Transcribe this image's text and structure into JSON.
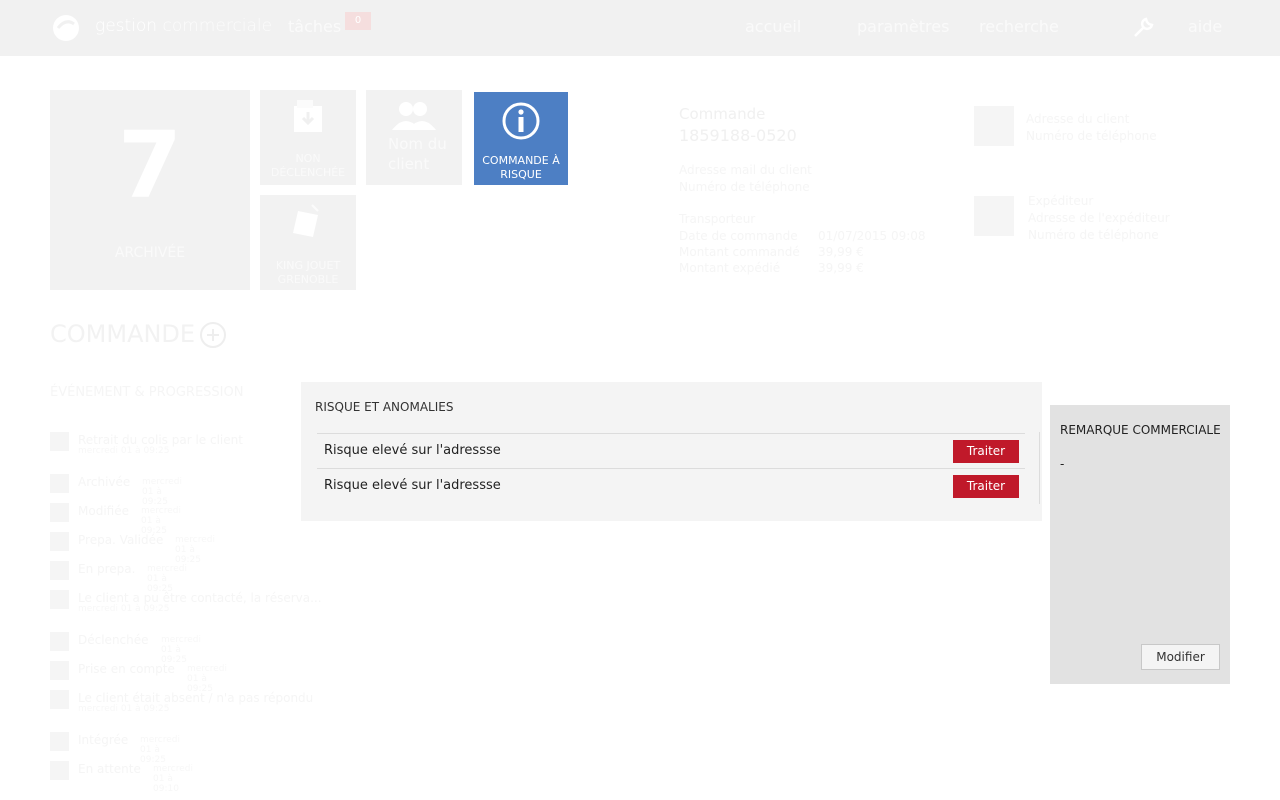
{
  "header": {
    "brand_main": "gestion",
    "brand_sub": "commerciale",
    "tasks_label": "tâches",
    "tasks_count": "0",
    "nav": [
      "accueil",
      "paramètres",
      "recherche",
      "aide"
    ]
  },
  "tiles": {
    "archived_count": "7",
    "archived_label": "ARCHIVÉE",
    "not_triggered_label": "NON DÉCLENCHÉE",
    "client_name_label": "Nom du client",
    "risk_label": "COMMANDE À RISQUE",
    "vendor_label": "KING JOUET GRENOBLE"
  },
  "order": {
    "label": "Commande",
    "number": "1859188-0520",
    "email_label": "Adresse mail du client",
    "phone_label": "Numéro de téléphone",
    "carrier_label": "Transporteur",
    "order_date_label": "Date de commande",
    "order_date": "01/07/2015 09:08",
    "order_amount_label": "Montant commandé",
    "order_amount": "39,99 €",
    "shipped_amount_label": "Montant expédié",
    "shipped_amount": "39,99 €",
    "client_address_label": "Adresse du client",
    "client_phone_label": "Numéro de téléphone",
    "sender_label": "Expéditeur",
    "sender_address_label": "Adresse de l'expéditeur",
    "sender_phone_label": "Numéro de téléphone"
  },
  "section": {
    "title": "COMMANDE",
    "events_title": "ÉVÉNEMENT & PROGRESSION"
  },
  "events": [
    {
      "icon": "grid",
      "text": "Retrait du colis par le client",
      "date": "mercredi 01 à 09:25",
      "sub": true
    },
    {
      "icon": "7",
      "text": "Archivée",
      "date": "mercredi 01 à 09:25",
      "sub": false
    },
    {
      "icon": "6",
      "text": "Modifiée",
      "date": "mercredi 01 à 09:25",
      "sub": false
    },
    {
      "icon": "5",
      "text": "Prepa. Validée",
      "date": "mercredi 01 à 09:25",
      "sub": false
    },
    {
      "icon": "4",
      "text": "En prepa.",
      "date": "mercredi 01 à 09:25",
      "sub": false
    },
    {
      "icon": "grid",
      "text": "Le client a pu être contacté, la réserva...",
      "date": "mercredi 01 à 09:25",
      "sub": true
    },
    {
      "icon": "3",
      "text": "Déclenchée",
      "date": "mercredi 01 à 09:25",
      "sub": false
    },
    {
      "icon": "2",
      "text": "Prise en compte",
      "date": "mercredi 01 à 09:25",
      "sub": false
    },
    {
      "icon": "grid",
      "text": "Le client était absent / n'a pas répondu",
      "date": "mercredi 01 à 09:25",
      "sub": true
    },
    {
      "icon": "1",
      "text": "Intégrée",
      "date": "mercredi 01 à 09:25",
      "sub": false
    },
    {
      "icon": "0",
      "text": "En attente",
      "date": "mercredi 01 à 09:10",
      "sub": false
    }
  ],
  "risk": {
    "title": "RISQUE ET ANOMALIES",
    "rows": [
      {
        "text": "Risque elevé sur l'adressse",
        "action": "Traiter"
      },
      {
        "text": "Risque elevé sur l'adressse",
        "action": "Traiter"
      }
    ]
  },
  "remark": {
    "title": "REMARQUE COMMERCIALE",
    "value": "-",
    "button": "Modifier"
  },
  "colors": {
    "accent_blue": "#4d7fc4",
    "danger_red": "#c0192a"
  }
}
